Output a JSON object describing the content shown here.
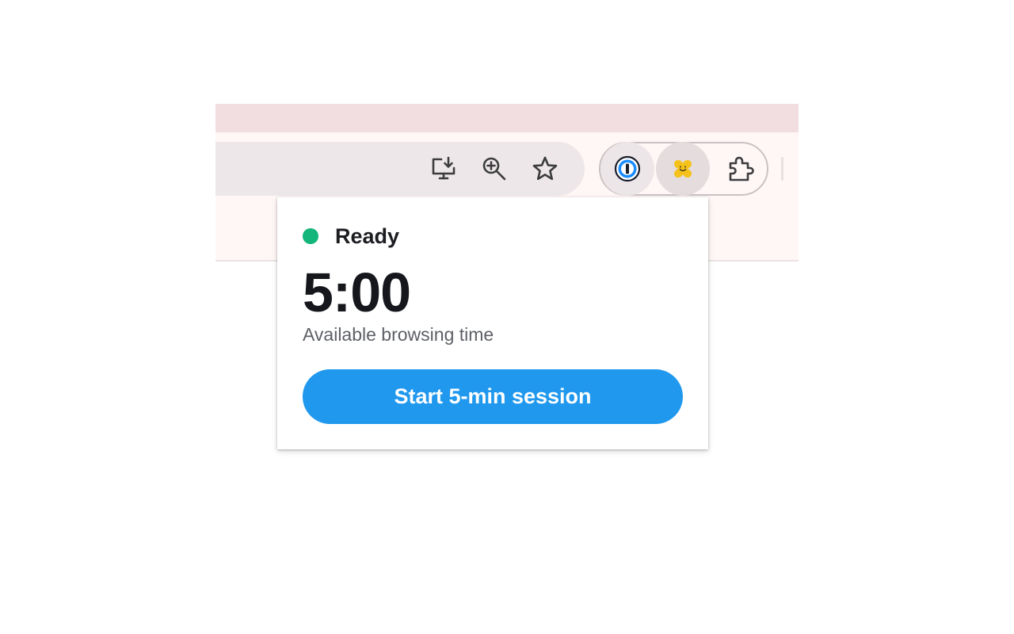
{
  "toolbar": {
    "icons": [
      "install-app-icon",
      "zoom-icon",
      "bookmark-star-icon"
    ],
    "extensions": [
      "1password-icon",
      "focus-extension-icon",
      "extensions-puzzle-icon"
    ]
  },
  "popup": {
    "status_label": "Ready",
    "status_color": "#13b57a",
    "time_value": "5:00",
    "time_caption": "Available browsing time",
    "start_button_label": "Start 5-min session",
    "accent_color": "#1f98ee"
  }
}
